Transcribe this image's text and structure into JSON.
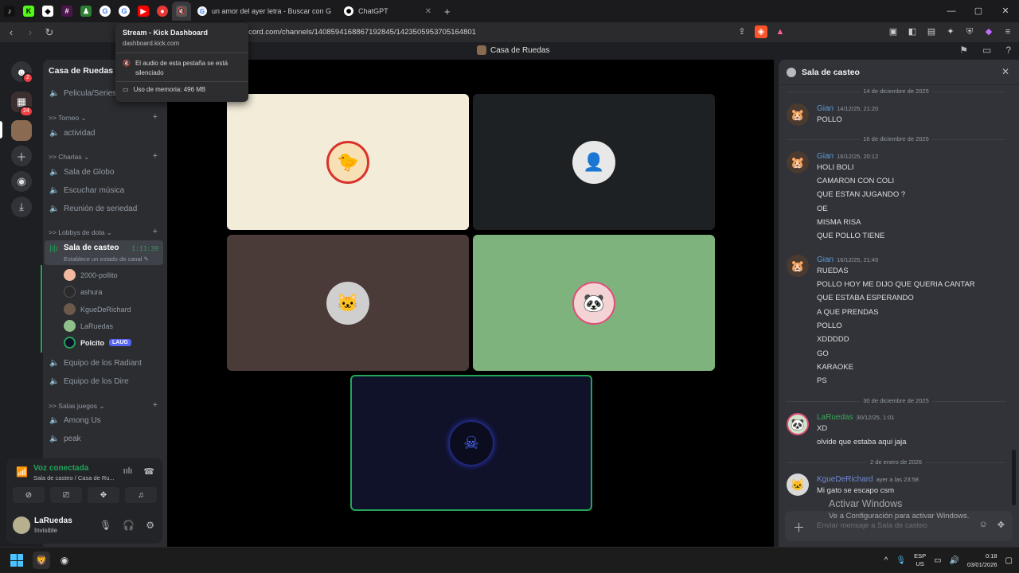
{
  "browser": {
    "tabs": [
      {
        "label": "un amor del ayer letra - Buscar con G"
      },
      {
        "label": "ChatGPT"
      }
    ],
    "new_tab": "+",
    "url": "discord.com/channels/1408594168867192845/1423505953705164801",
    "window_controls": [
      "—",
      "▢",
      "✕"
    ]
  },
  "tooltip": {
    "title": "Stream - Kick Dashboard",
    "domain": "dashboard.kick.com",
    "audio": "El audio de esta pestaña se está silenciado",
    "memory": "Uso de memoria: 496 MB"
  },
  "discord": {
    "title": "Casa de Ruedas",
    "rail_badges": {
      "home": "2",
      "folder": "24"
    },
    "server_name": "Casa de Ruedas",
    "channels": [
      {
        "label": "Pelicula/Series"
      },
      {
        "category": ">> Torneo"
      },
      {
        "label": "actividad"
      },
      {
        "category": ">> Charlas"
      },
      {
        "label": "Sala de Globo"
      },
      {
        "label": "Escuchar música"
      },
      {
        "label": "Reunión de seriedad"
      },
      {
        "category": ">> Lobbys de dota"
      }
    ],
    "active_channel": {
      "name": "Sala de casteo",
      "timer": "1:11:39",
      "status": "Establece un estado de canal"
    },
    "voice_users": [
      {
        "name": "2000-pollito"
      },
      {
        "name": "ashura"
      },
      {
        "name": "KgueDeRichard"
      },
      {
        "name": "LaRuedas"
      },
      {
        "name": "Polcito",
        "tag": "LAUG"
      }
    ],
    "channels_after": [
      {
        "label": "Equipo de los Radiant"
      },
      {
        "label": "Equipo de los Dire"
      },
      {
        "category": ">> Salas juegos"
      },
      {
        "label": "Among Us"
      },
      {
        "label": "peak"
      }
    ],
    "voice_panel": {
      "title": "Voz conectada",
      "subtitle": "Sala de casteo / Casa de Ru..."
    },
    "user": {
      "name": "LaRuedas",
      "status": "Invisible"
    },
    "chat": {
      "title": "Sala de casteo",
      "dividers": [
        "14 de diciembre de 2025",
        "16 de diciembre de 2025",
        "30 de diciembre de 2025",
        "2 de enero de 2026"
      ],
      "messages": [
        {
          "author": "Gian",
          "time": "14/12/25, 21:20",
          "lines": [
            "POLLO"
          ]
        },
        {
          "author": "Gian",
          "time": "16/12/25, 20:12",
          "lines": [
            "HOLI BOLI",
            "CAMARON CON COLI",
            "QUE ESTAN JUGANDO ?",
            "OE",
            "MISMA RISA",
            "QUE POLLO TIENE"
          ]
        },
        {
          "author": "Gian",
          "time": "16/12/25, 21:45",
          "lines": [
            "RUEDAS",
            "POLLO HOY ME DIJO QUE QUERIA CANTAR",
            "QUE ESTABA ESPERANDO",
            "A QUE PRENDAS",
            "POLLO",
            "XDDDDD",
            "GO",
            "KARAOKE",
            "PS"
          ]
        },
        {
          "author": "LaRuedas",
          "time": "30/12/25, 1:01",
          "lines": [
            "XD",
            "olvide que estaba aqui jaja"
          ]
        },
        {
          "author": "KgueDeRichard",
          "time": "ayer a las 23:58",
          "lines": [
            "Mi gato se escapo csm"
          ]
        }
      ],
      "placeholder": "Enviar mensaje a Sala de casteo"
    }
  },
  "watermark": {
    "line1": "Activar Windows",
    "line2": "Ve a Configuración para activar Windows."
  },
  "taskbar": {
    "lang": "ESP",
    "layout": "US",
    "time": "0:18",
    "date": "03/01/2026"
  },
  "colors": {
    "green": "#23a55a",
    "gian": "#5b9bd5",
    "laruedas": "#3ba55c",
    "kgue": "#7289da"
  }
}
